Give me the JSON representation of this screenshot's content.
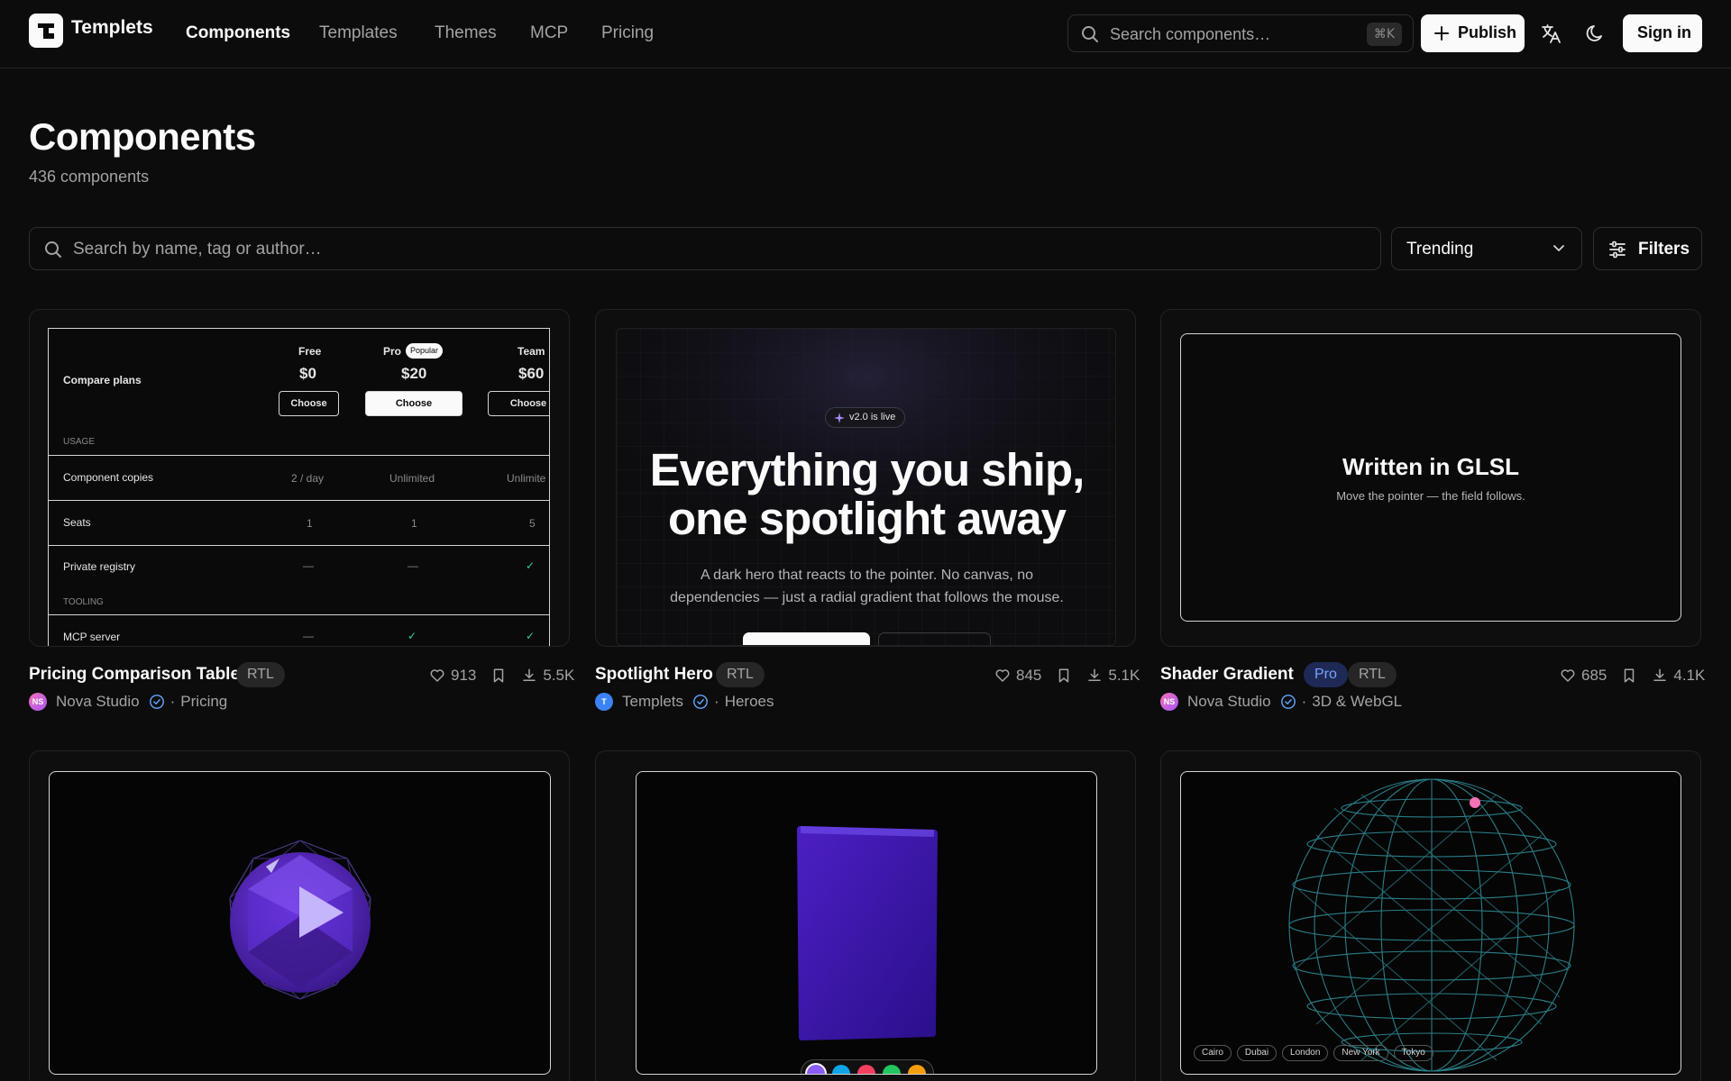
{
  "nav": {
    "logo_text": "Templets",
    "links": [
      "Components",
      "Templates",
      "Themes",
      "MCP",
      "Pricing"
    ],
    "search_placeholder": "Search components…",
    "search_shortcut": "⌘K",
    "publish_label": "Publish",
    "signin_label": "Sign in"
  },
  "page": {
    "title": "Components",
    "count": "436 components",
    "search_placeholder": "Search by name, tag or author…",
    "sort_value": "Trending",
    "filters_label": "Filters"
  },
  "cards": [
    {
      "title": "Pricing Comparison Table",
      "tags": [
        "RTL"
      ],
      "likes": "913",
      "downloads": "5.5K",
      "author": "Nova Studio",
      "author_initials": "NS",
      "category": "Pricing",
      "preview": {
        "heading": "Compare plans",
        "plans": [
          {
            "name": "Free",
            "price": "$0",
            "cta": "Choose"
          },
          {
            "name": "Pro",
            "badge": "Popular",
            "price": "$20",
            "cta": "Choose"
          },
          {
            "name": "Team",
            "price": "$60",
            "cta": "Choose"
          }
        ],
        "section_usage": "USAGE",
        "rows_usage": [
          {
            "label": "Component copies",
            "values": [
              "2 / day",
              "Unlimited",
              "Unlimite"
            ]
          },
          {
            "label": "Seats",
            "values": [
              "1",
              "1",
              "5"
            ]
          },
          {
            "label": "Private registry",
            "values": [
              "—",
              "—",
              "✓"
            ]
          }
        ],
        "section_tooling": "TOOLING",
        "rows_tooling": [
          {
            "label": "MCP server",
            "values": [
              "—",
              "✓",
              "✓"
            ]
          }
        ]
      }
    },
    {
      "title": "Spotlight Hero",
      "tags": [
        "RTL"
      ],
      "likes": "845",
      "downloads": "5.1K",
      "author": "Templets",
      "author_initials": "T",
      "category": "Heroes",
      "preview": {
        "badge": "v2.0 is live",
        "headline_1": "Everything you ship,",
        "headline_2": "one spotlight away",
        "sub_1": "A dark hero that reacts to the pointer. No canvas, no",
        "sub_2": "dependencies — just a radial gradient that follows the mouse."
      }
    },
    {
      "title": "Shader Gradient",
      "tags": [
        "Pro",
        "RTL"
      ],
      "likes": "685",
      "downloads": "4.1K",
      "author": "Nova Studio",
      "author_initials": "NS",
      "category": "3D & WebGL",
      "preview": {
        "headline": "Written in GLSL",
        "sub": "Move the pointer — the field follows."
      }
    }
  ],
  "row2": {
    "globe_cities": [
      "Cairo",
      "Dubai",
      "London",
      "New York",
      "Tokyo"
    ],
    "swatches": [
      "#8b5cf6",
      "#0ea5e9",
      "#f43f5e",
      "#22c55e",
      "#f59e0b"
    ]
  },
  "colors": {
    "background": "#0c0c0c",
    "accent_pro": "#7aa2ff",
    "verified": "#60a5fa"
  }
}
